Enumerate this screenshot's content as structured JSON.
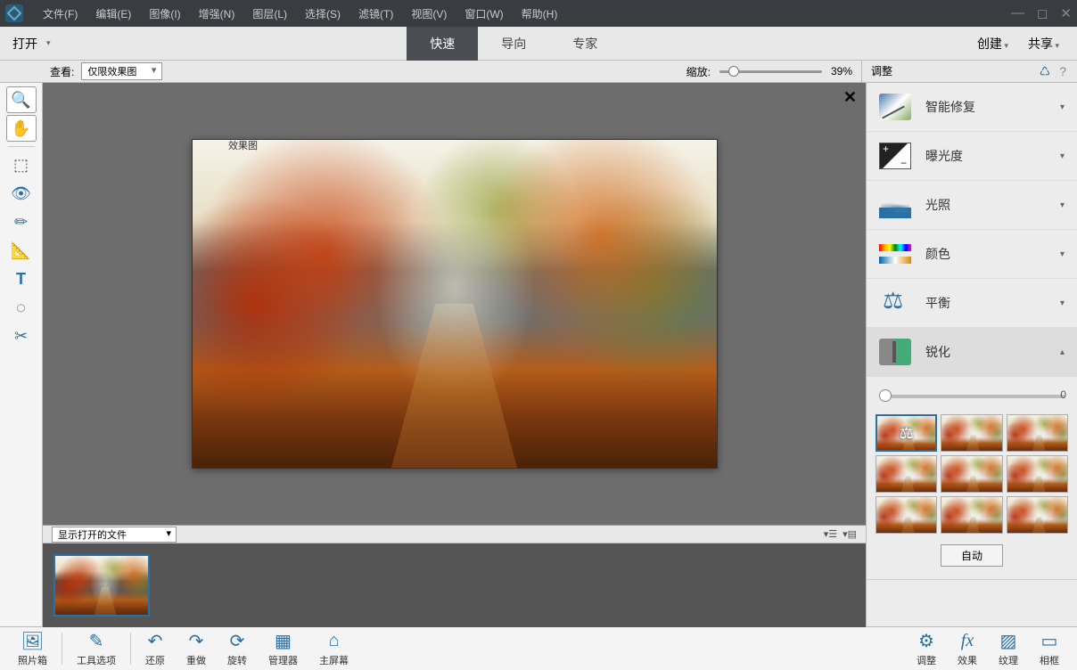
{
  "menu": {
    "items": [
      "文件(F)",
      "编辑(E)",
      "图像(I)",
      "增强(N)",
      "图层(L)",
      "选择(S)",
      "滤镜(T)",
      "视图(V)",
      "窗口(W)",
      "帮助(H)"
    ]
  },
  "secbar": {
    "open": "打开",
    "tabs": [
      "快速",
      "导向",
      "专家"
    ],
    "activeTab": 0,
    "right": [
      "创建",
      "共享"
    ]
  },
  "optbar": {
    "viewLabel": "查看:",
    "viewValue": "仅限效果图",
    "zoomLabel": "缩放:",
    "zoomValue": "39%",
    "panelTitle": "调整"
  },
  "canvas": {
    "label": "效果图",
    "stripDropdown": "显示打开的文件"
  },
  "adjust": {
    "items": [
      {
        "label": "智能修复",
        "icon": "i-smartfix"
      },
      {
        "label": "曝光度",
        "icon": "i-exposure"
      },
      {
        "label": "光照",
        "icon": "i-light"
      },
      {
        "label": "颜色",
        "icon": "i-color"
      },
      {
        "label": "平衡",
        "icon": "i-balance"
      },
      {
        "label": "锐化",
        "icon": "i-sharpen",
        "expanded": true
      }
    ],
    "slider": {
      "value": 0
    },
    "autoLabel": "自动"
  },
  "bottom": {
    "left": [
      {
        "label": "照片箱",
        "icon": "🖼"
      },
      {
        "label": "工具选项",
        "icon": "✎"
      },
      {
        "label": "还原",
        "icon": "↶"
      },
      {
        "label": "重做",
        "icon": "↷"
      },
      {
        "label": "旋转",
        "icon": "⟳"
      },
      {
        "label": "管理器",
        "icon": "▦"
      },
      {
        "label": "主屏幕",
        "icon": "⌂"
      }
    ],
    "right": [
      {
        "label": "调整",
        "icon": "⚙"
      },
      {
        "label": "效果",
        "icon": "fx"
      },
      {
        "label": "纹理",
        "icon": "▨"
      },
      {
        "label": "相框",
        "icon": "▭"
      }
    ]
  }
}
